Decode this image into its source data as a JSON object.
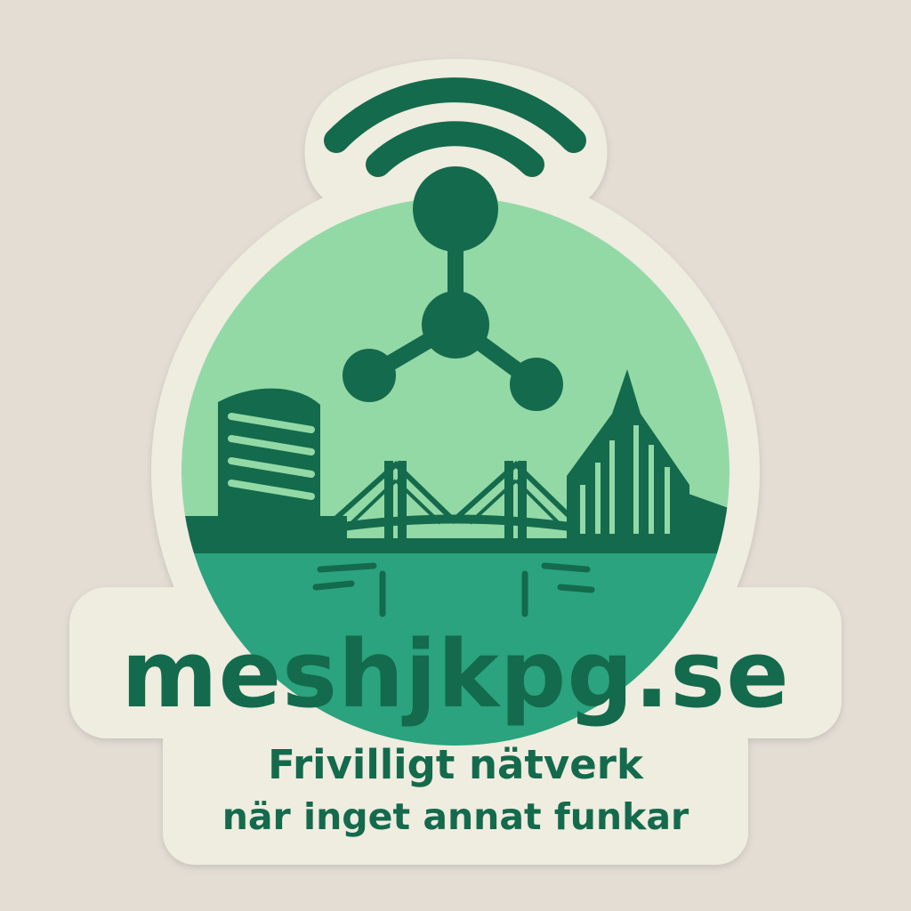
{
  "sticker": {
    "domain": "meshjkpg.se",
    "tagline_line1": "Frivilligt nätverk",
    "tagline_line2": "när inget annat funkar"
  },
  "icons": {
    "signal": "wifi-signal-icon",
    "mesh": "mesh-network-node-icon",
    "skyline": "city-skyline-illustration"
  },
  "colors": {
    "background": "#e3ddd4",
    "sticker_base": "#efece0",
    "dark_green": "#146a4c",
    "mid_green": "#1e7f5a",
    "light_green": "#93d9a6",
    "water": "#2aa37e",
    "water_light": "#45b88f"
  }
}
